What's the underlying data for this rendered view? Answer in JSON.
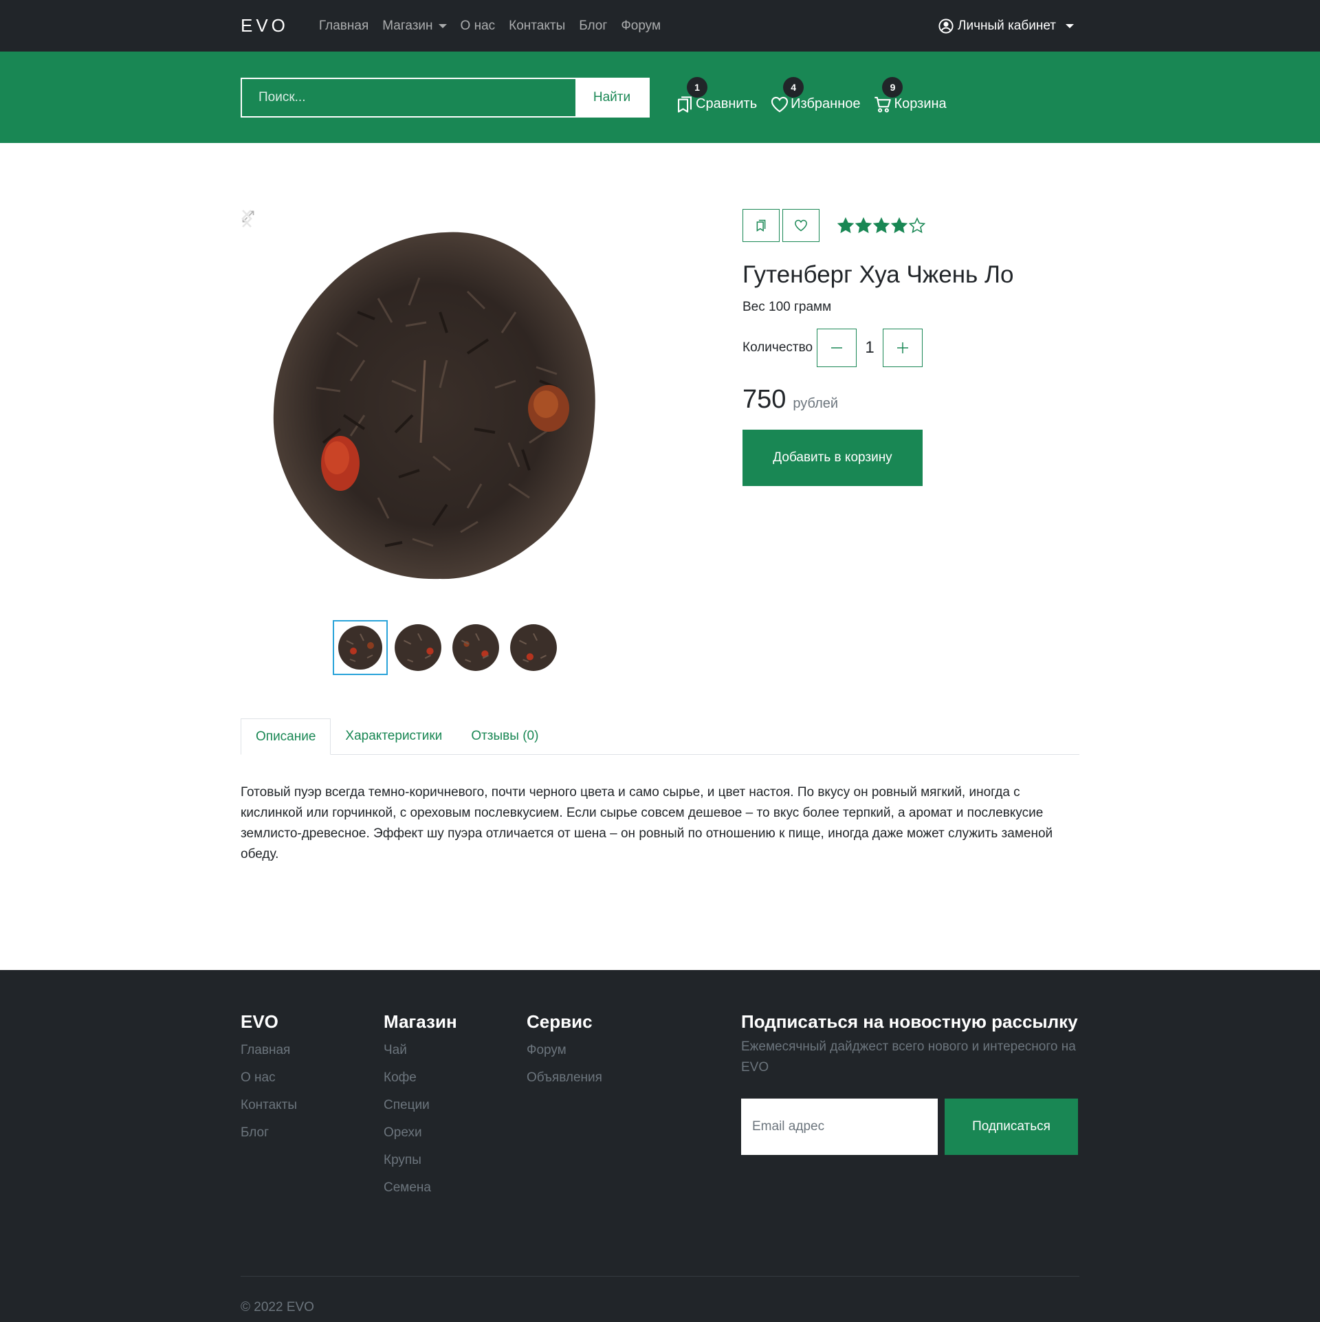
{
  "nav": {
    "brand": "EVO",
    "links": [
      "Главная",
      "Магазин",
      "О нас",
      "Контакты",
      "Блог",
      "Форум"
    ],
    "account_label": "Личный кабинет"
  },
  "search": {
    "placeholder": "Поиск...",
    "button_label": "Найти"
  },
  "quick_links": {
    "compare": {
      "label": "Сравнить",
      "count": "1"
    },
    "favorites": {
      "label": "Избранное",
      "count": "4"
    },
    "cart": {
      "label": "Корзина",
      "count": "9"
    }
  },
  "product": {
    "title": "Гутенберг Хуа Чжень Ло",
    "weight": "Вес 100 грамм",
    "qty_label": "Количество",
    "qty_value": "1",
    "price": "750",
    "price_unit": "рублей",
    "add_to_cart": "Добавить в корзину",
    "rating": 4,
    "rating_max": 5
  },
  "tabs": [
    "Описание",
    "Характеристики",
    "Отзывы (0)"
  ],
  "description": "Готовый пуэр всегда темно-коричневого, почти черного цвета и само сырье, и цвет настоя. По вкусу он ровный мягкий, иногда с кислинкой или горчинкой, с ореховым послевкусием. Если сырье совсем дешевое – то вкус более терпкий, а аромат и послевкусие землисто-древесное. Эффект шу пуэра отличается от шена – он ровный по отношению к пище, иногда даже может служить заменой обеду.",
  "footer": {
    "col1": {
      "title": "EVO",
      "links": [
        "Главная",
        "О нас",
        "Контакты",
        "Блог"
      ]
    },
    "col2": {
      "title": "Магазин",
      "links": [
        "Чай",
        "Кофе",
        "Специи",
        "Орехи",
        "Крупы",
        "Семена"
      ]
    },
    "col3": {
      "title": "Сервис",
      "links": [
        "Форум",
        "Объявления"
      ]
    },
    "subscribe": {
      "title": "Подписаться на новостную рассылку",
      "text": "Ежемесячный дайджест всего нового и интересного на EVO",
      "placeholder": "Email адрес",
      "button": "Подписаться"
    },
    "copyright": "© 2022 EVO"
  },
  "colors": {
    "brand_green": "#198754",
    "dark": "#212529",
    "muted": "#6c757d"
  }
}
